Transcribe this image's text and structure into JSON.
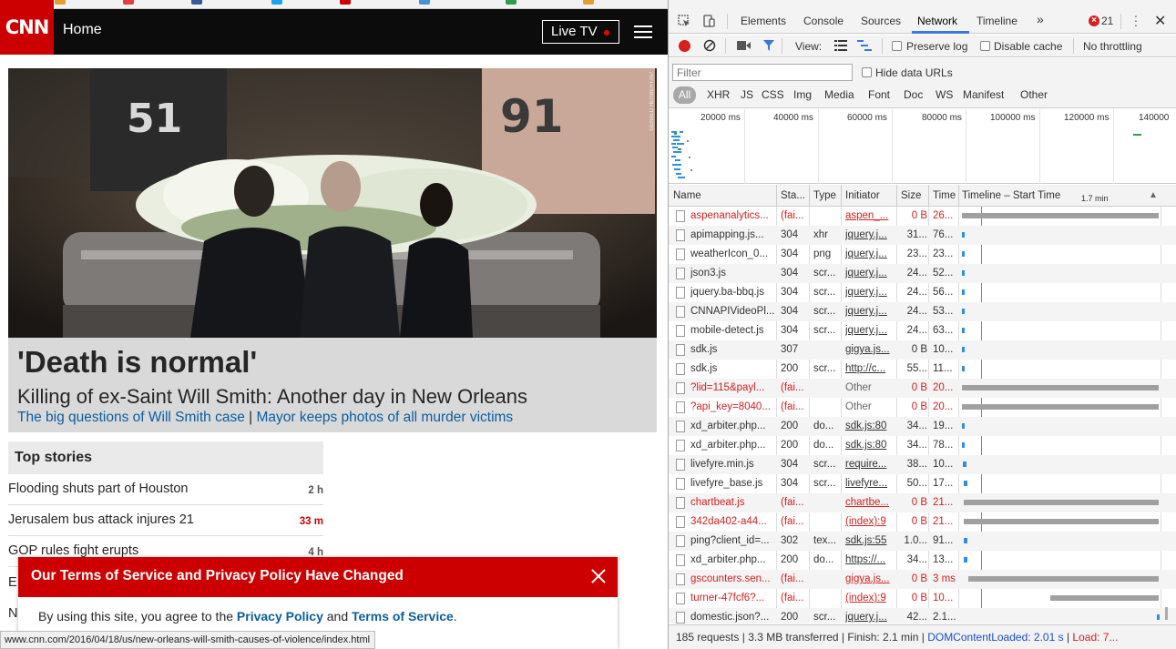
{
  "cnn": {
    "logo": "CNN",
    "nav_home": "Home",
    "live_tv": "Live TV",
    "hero": {
      "headline": "'Death is normal'",
      "subheadline": "Killing of ex-Saint Will Smith: Another day in New Orleans",
      "link1": "The big questions of Will Smith case",
      "separator": " | ",
      "link2": "Mayor keeps photos of all murder victims",
      "credit": "GERALD HERBERT/AP"
    },
    "top_stories": {
      "title": "Top stories",
      "items": [
        {
          "text": "Flooding shuts part of Houston",
          "time": "2 h",
          "hot": false
        },
        {
          "text": "Jerusalem bus attack injures 21",
          "time": "33 m",
          "hot": true
        },
        {
          "text": "GOP rules fight erupts",
          "time": "4 h",
          "hot": false
        }
      ],
      "partial1": "E",
      "partial2": "N"
    },
    "terms": {
      "title": "Our Terms of Service and Privacy Policy Have Changed",
      "body_prefix": "By using this site, you agree to the ",
      "privacy_link": "Privacy Policy",
      "and": " and ",
      "tos_link": "Terms of Service",
      "period": "."
    },
    "status_url": "www.cnn.com/2016/04/18/us/new-orleans-will-smith-causes-of-violence/index.html"
  },
  "devtools": {
    "tabs": [
      "Elements",
      "Console",
      "Sources",
      "Network",
      "Timeline"
    ],
    "active_tab": "Network",
    "more": "»",
    "error_count": "21",
    "toolbar": {
      "view_label": "View:",
      "preserve_log": "Preserve log",
      "disable_cache": "Disable cache",
      "throttling": "No throttling"
    },
    "filter": {
      "placeholder": "Filter",
      "hide_data_urls": "Hide data URLs",
      "types": [
        "All",
        "XHR",
        "JS",
        "CSS",
        "Img",
        "Media",
        "Font",
        "Doc",
        "WS",
        "Manifest",
        "Other"
      ]
    },
    "overview_ticks": [
      "20000 ms",
      "40000 ms",
      "60000 ms",
      "80000 ms",
      "100000 ms",
      "120000 ms",
      "140000"
    ],
    "columns": {
      "name": "Name",
      "status": "Sta...",
      "type": "Type",
      "initiator": "Initiator",
      "size": "Size",
      "time": "Time",
      "timeline": "Timeline – Start Time",
      "timeline_scale": "1.7 min"
    },
    "rows": [
      {
        "name": "aspenanalytics...",
        "status": "(fai...",
        "type": "",
        "initiator": "aspen_...",
        "size": "0 B",
        "time": "26...",
        "fail": true,
        "bar": {
          "start": 0.01,
          "len": 0.98,
          "color": "#a0a0a0"
        }
      },
      {
        "name": "apimapping.js...",
        "status": "304",
        "type": "xhr",
        "initiator": "jquery.j...",
        "size": "31...",
        "time": "76...",
        "fail": false,
        "bar": {
          "start": 0.01,
          "len": 0.015,
          "color": "#2e8ee6"
        }
      },
      {
        "name": "weatherIcon_0...",
        "status": "304",
        "type": "png",
        "initiator": "jquery.j...",
        "size": "23...",
        "time": "23...",
        "fail": false,
        "bar": {
          "start": 0.01,
          "len": 0.015,
          "color": "#2e8ee6"
        }
      },
      {
        "name": "json3.js",
        "status": "304",
        "type": "scr...",
        "initiator": "jquery.j...",
        "size": "24...",
        "time": "52...",
        "fail": false,
        "bar": {
          "start": 0.01,
          "len": 0.015,
          "color": "#2e8ee6"
        }
      },
      {
        "name": "jquery.ba-bbq.js",
        "status": "304",
        "type": "scr...",
        "initiator": "jquery.j...",
        "size": "24...",
        "time": "56...",
        "fail": false,
        "bar": {
          "start": 0.01,
          "len": 0.015,
          "color": "#2e8ee6"
        }
      },
      {
        "name": "CNNAPIVideoPl...",
        "status": "304",
        "type": "scr...",
        "initiator": "jquery.j...",
        "size": "24...",
        "time": "53...",
        "fail": false,
        "bar": {
          "start": 0.01,
          "len": 0.015,
          "color": "#2e8ee6"
        }
      },
      {
        "name": "mobile-detect.js",
        "status": "304",
        "type": "scr...",
        "initiator": "jquery.j...",
        "size": "24...",
        "time": "63...",
        "fail": false,
        "bar": {
          "start": 0.01,
          "len": 0.015,
          "color": "#2e8ee6"
        }
      },
      {
        "name": "sdk.js",
        "status": "307",
        "type": "",
        "initiator": "gigya.js...",
        "size": "0 B",
        "time": "10...",
        "fail": false,
        "bar": {
          "start": 0.01,
          "len": 0.015,
          "color": "#2e8ee6"
        }
      },
      {
        "name": "sdk.js",
        "status": "200",
        "type": "scr...",
        "initiator": "http://c...",
        "size": "55...",
        "time": "11...",
        "fail": false,
        "bar": {
          "start": 0.01,
          "len": 0.015,
          "color": "#2e8ee6"
        }
      },
      {
        "name": "?lid=115&payl...",
        "status": "(fai...",
        "type": "",
        "initiator": "Other",
        "size": "0 B",
        "time": "20...",
        "fail": true,
        "plain_initiator": true,
        "bar": {
          "start": 0.01,
          "len": 0.98,
          "color": "#a0a0a0"
        }
      },
      {
        "name": "?api_key=8040...",
        "status": "(fai...",
        "type": "",
        "initiator": "Other",
        "size": "0 B",
        "time": "20...",
        "fail": true,
        "plain_initiator": true,
        "bar": {
          "start": 0.01,
          "len": 0.98,
          "color": "#a0a0a0"
        }
      },
      {
        "name": "xd_arbiter.php...",
        "status": "200",
        "type": "do...",
        "initiator": "sdk.js:80",
        "size": "34...",
        "time": "19...",
        "fail": false,
        "bar": {
          "start": 0.01,
          "len": 0.015,
          "color": "#2e8ee6"
        }
      },
      {
        "name": "xd_arbiter.php...",
        "status": "200",
        "type": "do...",
        "initiator": "sdk.js:80",
        "size": "34...",
        "time": "78...",
        "fail": false,
        "bar": {
          "start": 0.01,
          "len": 0.015,
          "color": "#2e8ee6"
        }
      },
      {
        "name": "livefyre.min.js",
        "status": "304",
        "type": "scr...",
        "initiator": "require...",
        "size": "38...",
        "time": "10...",
        "fail": false,
        "bar": {
          "start": 0.015,
          "len": 0.015,
          "color": "#2e8ee6"
        }
      },
      {
        "name": "livefyre_base.js",
        "status": "304",
        "type": "scr...",
        "initiator": "livefyre...",
        "size": "50...",
        "time": "17...",
        "fail": false,
        "bar": {
          "start": 0.02,
          "len": 0.015,
          "color": "#2e8ee6"
        }
      },
      {
        "name": "chartbeat.js",
        "status": "(fai...",
        "type": "",
        "initiator": "chartbe...",
        "size": "0 B",
        "time": "21...",
        "fail": true,
        "bar": {
          "start": 0.02,
          "len": 0.97,
          "color": "#a0a0a0"
        }
      },
      {
        "name": "342da402-a44...",
        "status": "(fai...",
        "type": "",
        "initiator": "(index):9",
        "size": "0 B",
        "time": "21...",
        "fail": true,
        "bar": {
          "start": 0.02,
          "len": 0.97,
          "color": "#a0a0a0"
        }
      },
      {
        "name": "ping?client_id=...",
        "status": "302",
        "type": "tex...",
        "initiator": "sdk.js:55",
        "size": "1.0...",
        "time": "91...",
        "fail": false,
        "bar": {
          "start": 0.02,
          "len": 0.015,
          "color": "#2e8ee6"
        }
      },
      {
        "name": "xd_arbiter.php...",
        "status": "200",
        "type": "do...",
        "initiator": "https://...",
        "size": "34...",
        "time": "13...",
        "fail": false,
        "bar": {
          "start": 0.02,
          "len": 0.015,
          "color": "#2e8ee6"
        }
      },
      {
        "name": "gscounters.sen...",
        "status": "(fai...",
        "type": "",
        "initiator": "gigya.js...",
        "size": "0 B",
        "time": "3 ms",
        "fail": true,
        "bar": {
          "start": 0.04,
          "len": 0.95,
          "color": "#a0a0a0"
        }
      },
      {
        "name": "turner-47fcf6?...",
        "status": "(fai...",
        "type": "",
        "initiator": "(index):9",
        "size": "0 B",
        "time": "10...",
        "fail": true,
        "bar": {
          "start": 0.45,
          "len": 0.54,
          "color": "#a0a0a0"
        }
      },
      {
        "name": "domestic.json?...",
        "status": "200",
        "type": "scr...",
        "initiator": "jquery.j...",
        "size": "42...",
        "time": "2.1...",
        "fail": false,
        "bar": {
          "start": 0.98,
          "len": 0.015,
          "color": "#2e8ee6"
        }
      }
    ],
    "footer": {
      "requests": "185 requests",
      "sep": " | ",
      "transferred": "3.3 MB transferred",
      "finish": "Finish: 2.1 min",
      "dcl": "DOMContentLoaded: 2.01 s",
      "load": "Load: 7..."
    }
  }
}
